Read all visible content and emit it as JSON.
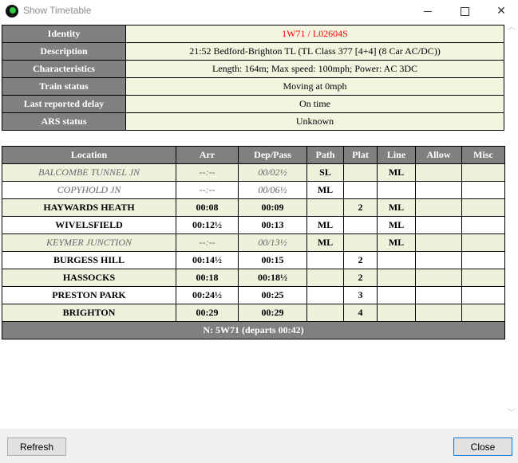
{
  "window": {
    "title": "Show Timetable"
  },
  "info": [
    {
      "label": "Identity",
      "value": "1W71 / L02604S"
    },
    {
      "label": "Description",
      "value": "21:52 Bedford-Brighton TL (TL Class 377 [4+4] (8 Car AC/DC))"
    },
    {
      "label": "Characteristics",
      "value": "Length: 164m; Max speed: 100mph; Power: AC 3DC"
    },
    {
      "label": "Train status",
      "value": "Moving at 0mph"
    },
    {
      "label": "Last reported delay",
      "value": "On time"
    },
    {
      "label": "ARS status",
      "value": "Unknown"
    }
  ],
  "timetable": {
    "headers": [
      "Location",
      "Arr",
      "Dep/Pass",
      "Path",
      "Plat",
      "Line",
      "Allow",
      "Misc"
    ],
    "rows": [
      {
        "location": "BALCOMBE TUNNEL JN",
        "arr": "--:--",
        "dep": "00/02½",
        "path": "SL",
        "plat": "",
        "line": "ML",
        "allow": "",
        "misc": ""
      },
      {
        "location": "COPYHOLD JN",
        "arr": "--:--",
        "dep": "00/06½",
        "path": "ML",
        "plat": "",
        "line": "",
        "allow": "",
        "misc": ""
      },
      {
        "location": "HAYWARDS HEATH",
        "arr": "00:08",
        "dep": "00:09",
        "path": "",
        "plat": "2",
        "line": "ML",
        "allow": "",
        "misc": ""
      },
      {
        "location": "WIVELSFIELD",
        "arr": "00:12½",
        "dep": "00:13",
        "path": "ML",
        "plat": "",
        "line": "ML",
        "allow": "",
        "misc": ""
      },
      {
        "location": "KEYMER JUNCTION",
        "arr": "--:--",
        "dep": "00/13½",
        "path": "ML",
        "plat": "",
        "line": "ML",
        "allow": "",
        "misc": ""
      },
      {
        "location": "BURGESS HILL",
        "arr": "00:14½",
        "dep": "00:15",
        "path": "",
        "plat": "2",
        "line": "",
        "allow": "",
        "misc": ""
      },
      {
        "location": "HASSOCKS",
        "arr": "00:18",
        "dep": "00:18½",
        "path": "",
        "plat": "2",
        "line": "",
        "allow": "",
        "misc": ""
      },
      {
        "location": "PRESTON PARK",
        "arr": "00:24½",
        "dep": "00:25",
        "path": "",
        "plat": "3",
        "line": "",
        "allow": "",
        "misc": ""
      },
      {
        "location": "BRIGHTON",
        "arr": "00:29",
        "dep": "00:29",
        "path": "",
        "plat": "4",
        "line": "",
        "allow": "",
        "misc": ""
      }
    ],
    "footer": "N: 5W71 (departs 00:42)"
  },
  "buttons": {
    "refresh": "Refresh",
    "close": "Close"
  },
  "colors": {
    "header_bg": "#808080",
    "row_tint": "#eef2dd",
    "identity_text": "#ff0000"
  }
}
